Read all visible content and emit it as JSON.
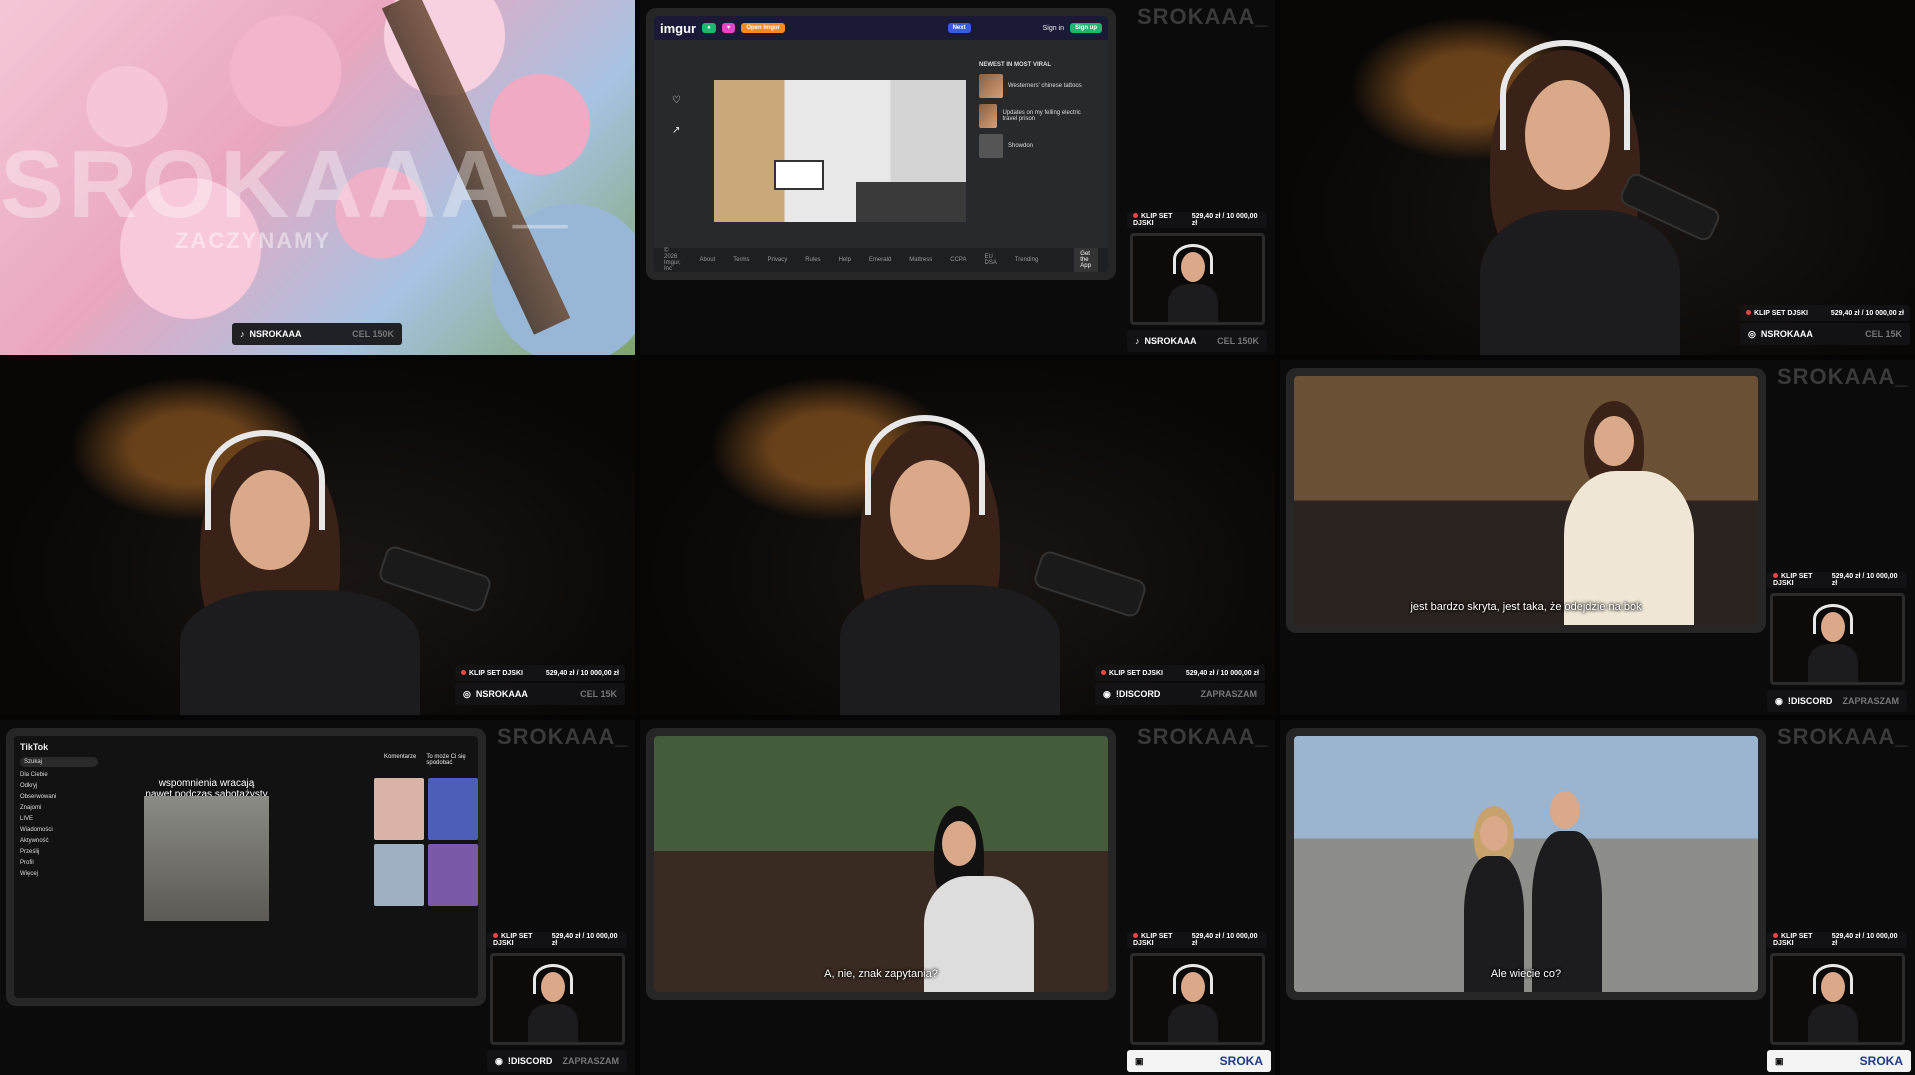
{
  "watermark": "SROKAAA_",
  "tile1": {
    "big_watermark": "SROKAAA_",
    "sub_text": "ZACZYNAMY",
    "social_handle": "NSROKAAA",
    "social_goal": "CEL 150K"
  },
  "imgur": {
    "logo": "imgur",
    "open_app": "Open Imgur",
    "next": "Next",
    "sign_in": "Sign in",
    "sign_up": "Sign up",
    "newest_label": "NEWEST IN MOST VIRAL",
    "items": [
      {
        "title": "Westerners' chinese tattoos"
      },
      {
        "title": "Updates on my felling electric travel prison"
      },
      {
        "title": "Showdon"
      }
    ],
    "footer": [
      "© 2026 Imgur, Inc",
      "About",
      "Terms",
      "Privacy",
      "Rules",
      "Help",
      "Emerald",
      "Mattress",
      "CCPA",
      "EU DSA",
      "Trending"
    ],
    "get_app": "Get the App"
  },
  "goal": {
    "label": "KLIP SET DJSKI",
    "value": "529,40 zł / 10 000,00 zł"
  },
  "socials": {
    "tiktok": {
      "handle": "NSROKAAA",
      "goal": "CEL 150K"
    },
    "instagram": {
      "handle": "NSROKAAA",
      "goal": "CEL 15K"
    },
    "discord": {
      "handle": "!DISCORD",
      "goal": "ZAPRASZAM"
    }
  },
  "subtitles": {
    "cafe": "jest bardzo skryta, jest taka, że odejdzie na bok",
    "room": "A, nie, znak zapytania?",
    "street": "Ale wiecie co?"
  },
  "tiktok": {
    "logo": "TikTok",
    "search": "Szukaj",
    "menu": [
      "Dla Ciebie",
      "Odkryj",
      "Obserwowani",
      "Znajomi",
      "LIVE",
      "Wiadomości",
      "Aktywność",
      "Prześlij",
      "Profil",
      "Więcej"
    ],
    "caption": "wspomnienia wracają nawet podczas sabotażysty",
    "tabs": [
      "Komentarze",
      "To może Ci się spodobać"
    ]
  },
  "sponsor": "SROKA"
}
